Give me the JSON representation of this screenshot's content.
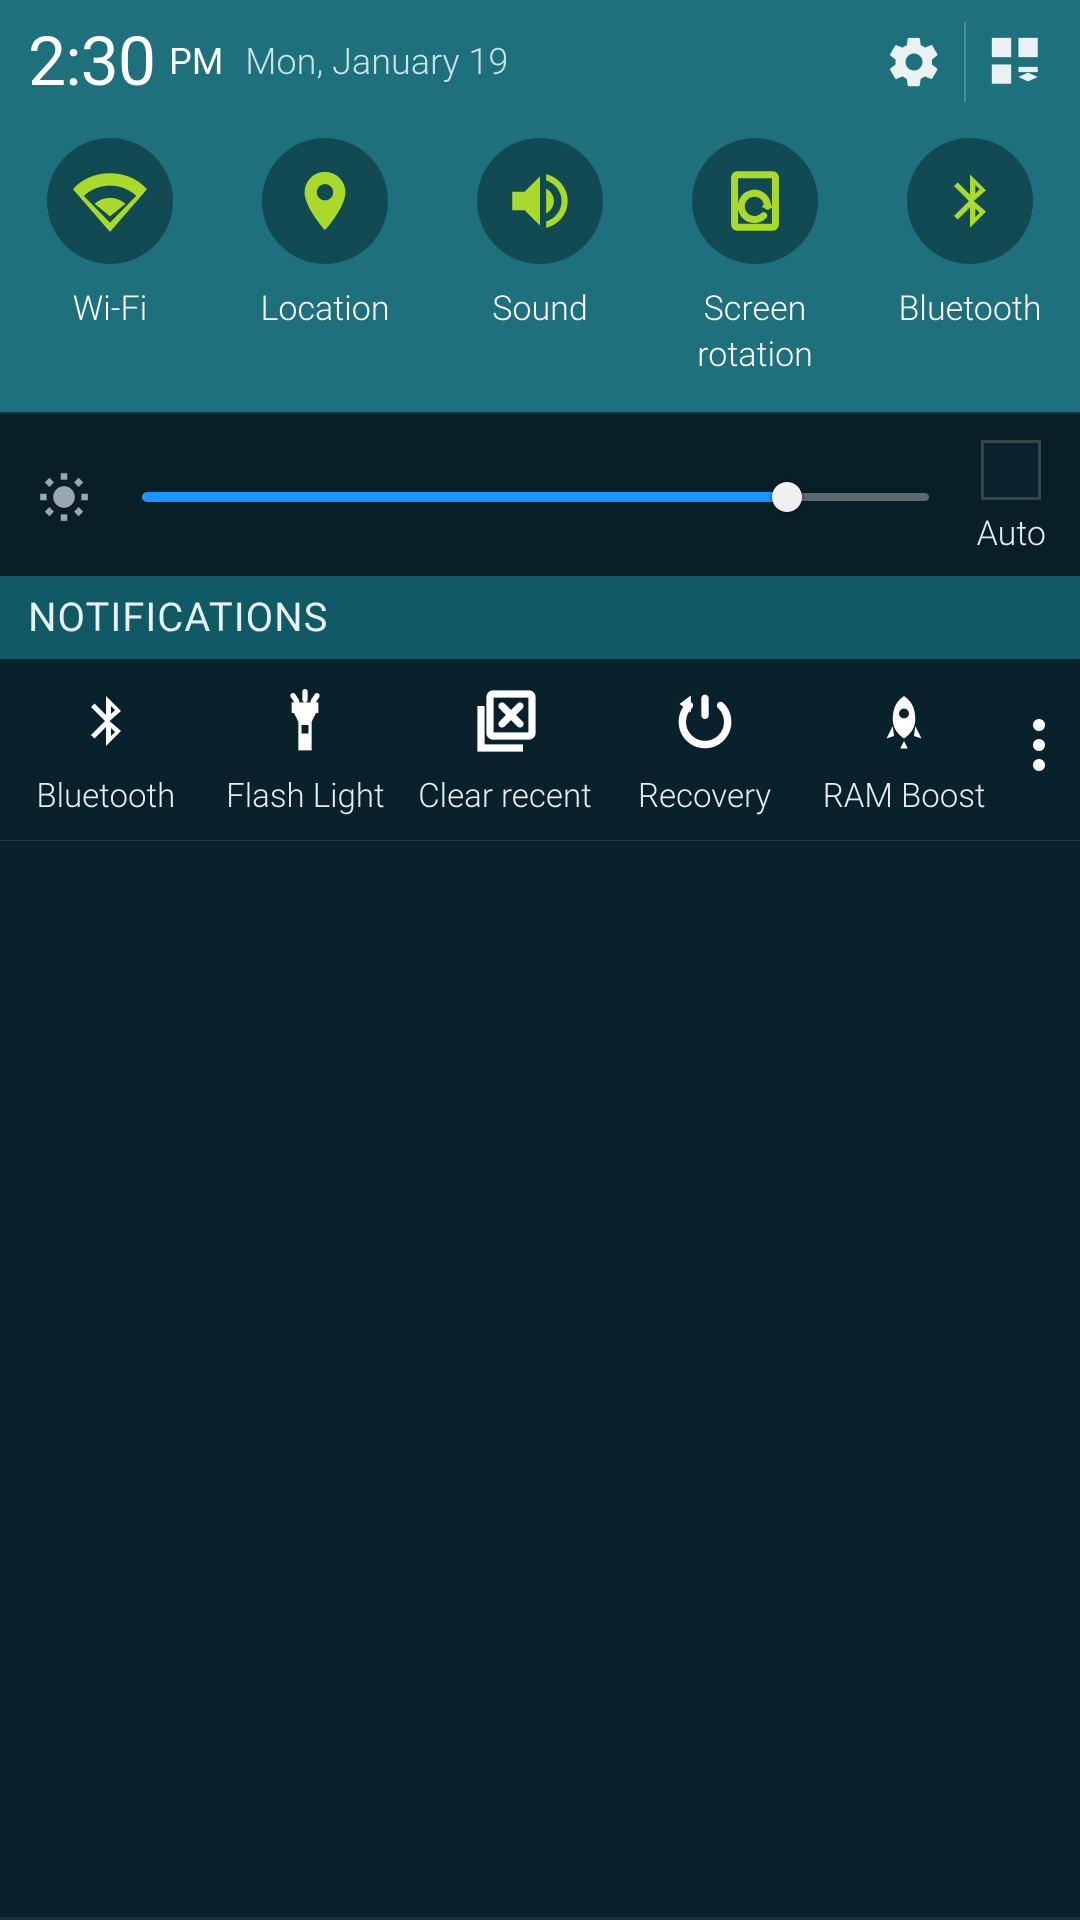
{
  "header": {
    "time": "2:30",
    "ampm": "PM",
    "date": "Mon, January 19"
  },
  "quick": {
    "tiles": [
      {
        "id": "wifi",
        "label": "Wi-Fi",
        "icon": "wifi"
      },
      {
        "id": "location",
        "label": "Location",
        "icon": "location"
      },
      {
        "id": "sound",
        "label": "Sound",
        "icon": "sound"
      },
      {
        "id": "rotation",
        "label": "Screen\nrotation",
        "icon": "rotation"
      },
      {
        "id": "bluetooth",
        "label": "Bluetooth",
        "icon": "bluetooth"
      }
    ],
    "accent_active": "#a9d92a"
  },
  "brightness": {
    "value_pct": 82,
    "auto_label": "Auto",
    "auto_checked": false
  },
  "notifications": {
    "header": "NOTIFICATIONS"
  },
  "actions": {
    "items": [
      {
        "id": "bt",
        "label": "Bluetooth",
        "icon": "bluetooth-w"
      },
      {
        "id": "flash",
        "label": "Flash Light",
        "icon": "flash"
      },
      {
        "id": "clear",
        "label": "Clear recent",
        "icon": "clear"
      },
      {
        "id": "recovery",
        "label": "Recovery",
        "icon": "recovery"
      },
      {
        "id": "ramboost",
        "label": "RAM Boost",
        "icon": "ramboost"
      }
    ]
  },
  "colors": {
    "panel_teal": "#1e707c",
    "tile_bg": "#124a53",
    "bg_dark": "#08212b",
    "slider_fill": "#1796ff"
  }
}
